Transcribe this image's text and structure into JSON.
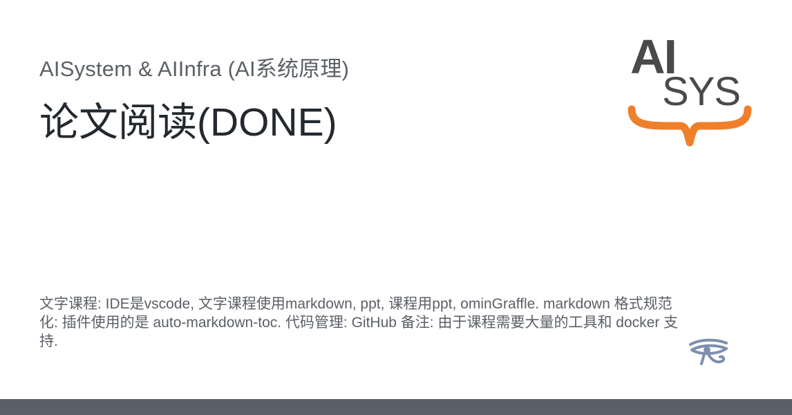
{
  "header": {
    "subtitle": "AISystem & AIInfra (AI系统原理)",
    "title": "论文阅读(DONE)"
  },
  "logo": {
    "top_text": "AI",
    "bottom_text": "SYS",
    "colors": {
      "text": "#4a4a4a",
      "brace": "#f07f2a"
    }
  },
  "description": {
    "text": "文字课程: IDE是vscode, 文字课程使用markdown, ppt, 课程用ppt, ominGraffle. markdown 格式规范化: 插件使用的是 auto-markdown-toc. 代码管理: GitHub 备注: 由于课程需要大量的工具和 docker 支持."
  },
  "icons": {
    "bottom_right": "eye-of-horus-icon"
  },
  "colors": {
    "footer": "#5b5f67",
    "title": "#24292f",
    "subtitle": "#5b5f66"
  }
}
